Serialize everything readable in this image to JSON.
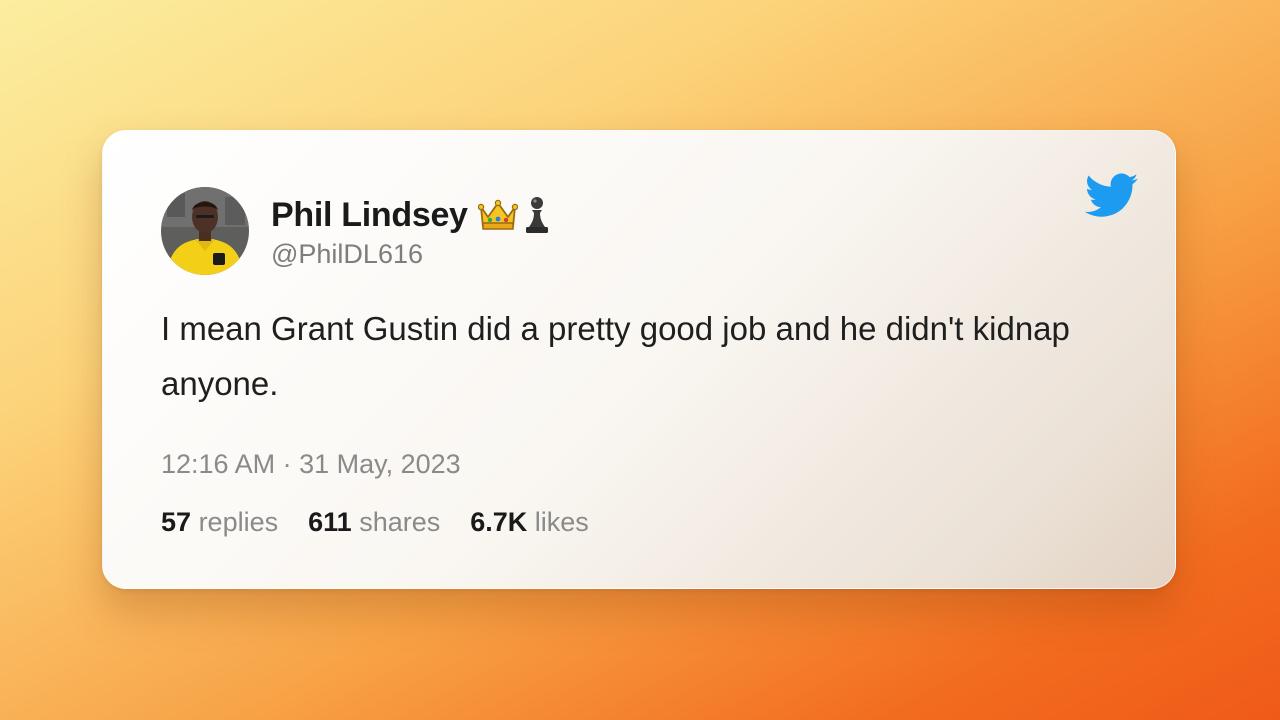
{
  "tweet": {
    "display_name": "Phil Lindsey",
    "badges": [
      "crown-emoji-icon",
      "chess-pawn-emoji-icon"
    ],
    "handle": "@PhilDL616",
    "text": "I mean Grant Gustin did a pretty good job and he didn't kidnap anyone.",
    "timestamp": "12:16 AM · 31 May, 2023",
    "stats": {
      "replies_count": "57",
      "replies_label": "replies",
      "shares_count": "611",
      "shares_label": "shares",
      "likes_count": "6.7K",
      "likes_label": "likes"
    }
  },
  "colors": {
    "twitter_blue": "#1d9bf0",
    "background_gradient": [
      "#fbeea0",
      "#f26c1f"
    ]
  },
  "icons": {
    "brand": "twitter-bird-icon"
  }
}
